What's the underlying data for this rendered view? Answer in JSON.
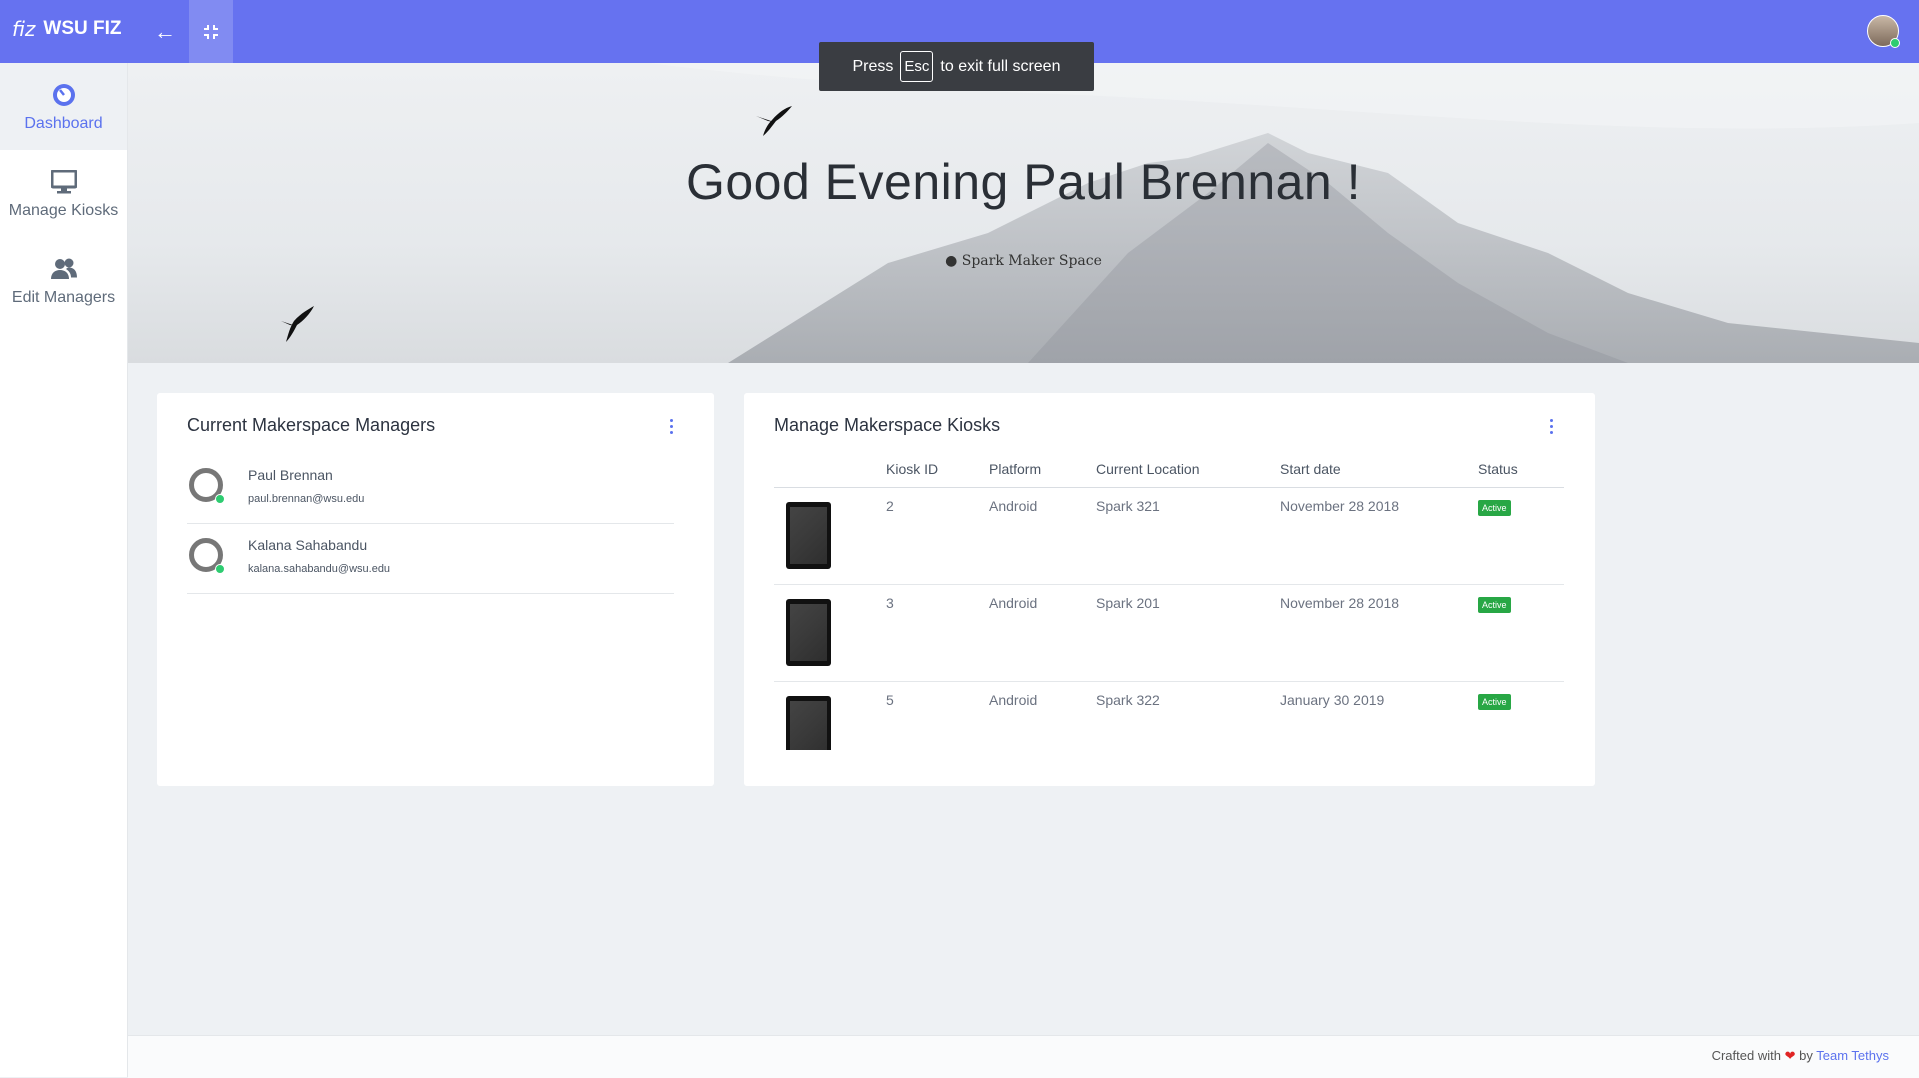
{
  "app": {
    "logo": "fiz",
    "name": "WSU FIZ"
  },
  "sidebar": {
    "items": [
      {
        "label": "Dashboard",
        "icon": "dashboard-icon"
      },
      {
        "label": "Manage Kiosks",
        "icon": "monitor-icon"
      },
      {
        "label": "Edit Managers",
        "icon": "users-icon"
      }
    ]
  },
  "hero": {
    "greeting": "Good Evening Paul Brennan !",
    "location": "Spark Maker Space"
  },
  "toast": {
    "prefix": "Press",
    "key": "Esc",
    "suffix": "to exit full screen"
  },
  "managers_card": {
    "title": "Current Makerspace Managers",
    "managers": [
      {
        "name": "Paul Brennan",
        "email": "paul.brennan@wsu.edu"
      },
      {
        "name": "Kalana Sahabandu",
        "email": "kalana.sahabandu@wsu.edu"
      }
    ]
  },
  "kiosks_card": {
    "title": "Manage Makerspace Kiosks",
    "columns": [
      "Kiosk ID",
      "Platform",
      "Current Location",
      "Start date",
      "Status"
    ],
    "rows": [
      {
        "id": "2",
        "platform": "Android",
        "location": "Spark 321",
        "start": "November 28 2018",
        "status": "Active"
      },
      {
        "id": "3",
        "platform": "Android",
        "location": "Spark 201",
        "start": "November 28 2018",
        "status": "Active"
      },
      {
        "id": "5",
        "platform": "Android",
        "location": "Spark 322",
        "start": "January 30 2019",
        "status": "Active"
      }
    ]
  },
  "footer": {
    "prefix": "Crafted with",
    "middle": "by",
    "link": "Team Tethys"
  },
  "colors": {
    "topbar": "#6672f0",
    "accent": "#5b72ee",
    "active_badge": "#28a745"
  }
}
